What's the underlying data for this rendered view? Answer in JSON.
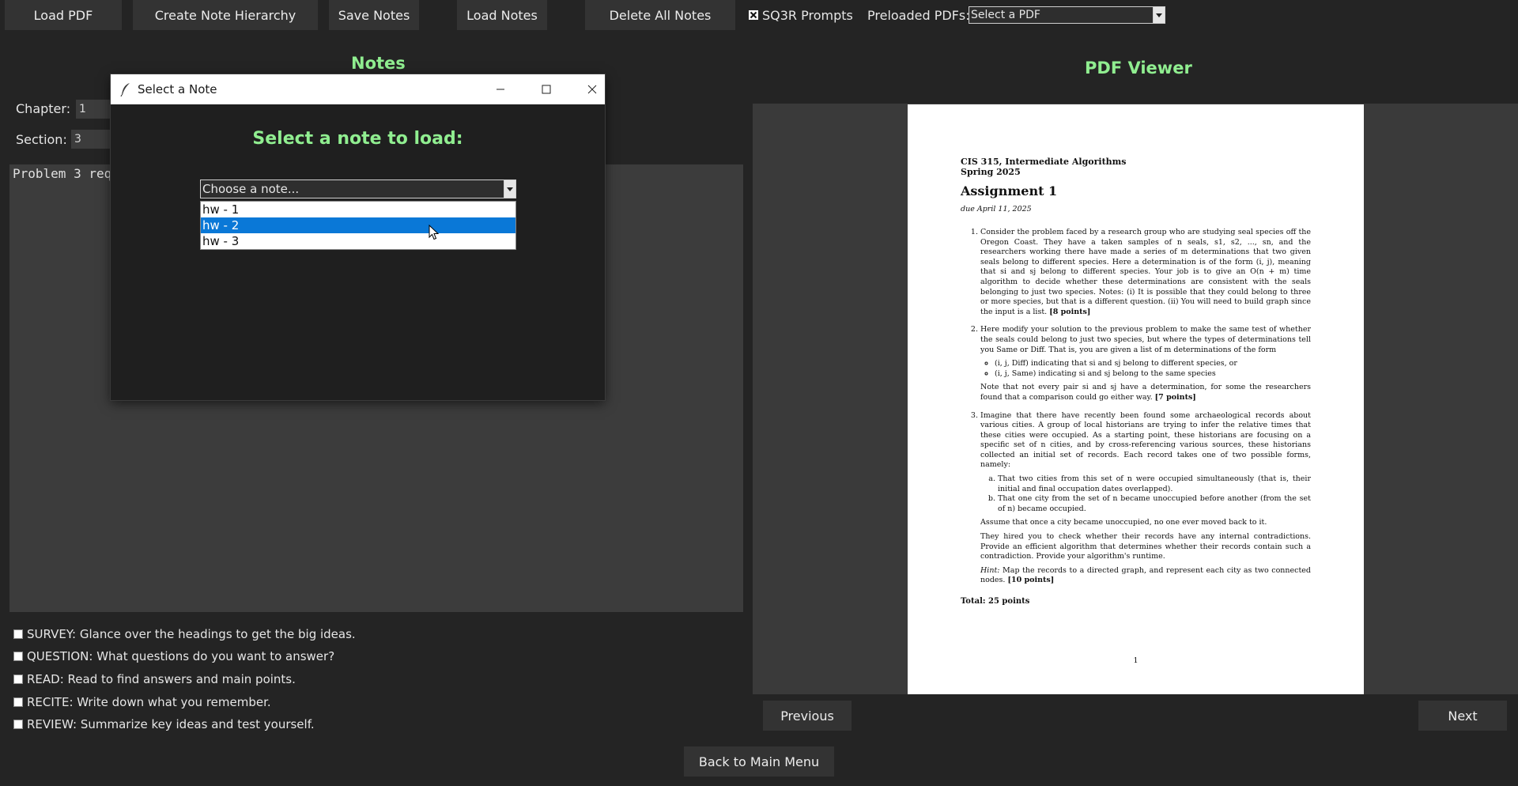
{
  "toolbar": {
    "load_pdf": "Load PDF",
    "create_note_hierarchy": "Create Note Hierarchy",
    "save_notes": "Save Notes",
    "load_notes": "Load Notes",
    "delete_all_notes": "Delete All Notes",
    "sq3r_label": "SQ3R Prompts",
    "sq3r_checked": true,
    "preloaded_label": "Preloaded PDFs:",
    "preloaded_value": "Select a PDF"
  },
  "notes": {
    "heading": "Notes",
    "chapter_label": "Chapter:",
    "chapter_value": "1",
    "section_label": "Section:",
    "section_value": "3",
    "text": "Problem 3 req"
  },
  "sq3r": [
    "SURVEY: Glance over the headings to get the big ideas.",
    "QUESTION: What questions do you want to answer?",
    "READ: Read to find answers and main points.",
    "RECITE: Write down what you remember.",
    "REVIEW: Summarize key ideas and test yourself."
  ],
  "pdf_viewer": {
    "heading": "PDF Viewer",
    "previous": "Previous",
    "next": "Next",
    "document": {
      "course": "CIS 315, Intermediate Algorithms",
      "term": "Spring 2025",
      "title": "Assignment 1",
      "due": "due April 11, 2025",
      "p1": "Consider the problem faced by a research group who are studying seal species off the Oregon Coast. They have a taken samples of n seals, s1, s2, ..., sn, and the researchers working there have made a series of m determinations that two given seals belong to different species. Here a determination is of the form (i, j), meaning that si and sj belong to different species. Your job is to give an O(n + m) time algorithm to decide whether these determinations are consistent with the seals belonging to just two species. Notes: (i) It is possible that they could belong to three or more species, but that is a different question. (ii) You will need to build graph since the input is a list.",
      "p1_points": "[8 points]",
      "p2": "Here modify your solution to the previous problem to make the same test of whether the seals could belong to just two species, but where the types of determinations tell you Same or Diff. That is, you are given a list of m determinations of the form",
      "p2_b1": "(i, j, Diff) indicating that si and sj belong to different species, or",
      "p2_b2": "(i, j, Same) indicating si and sj belong to the same species",
      "p2_note": "Note that not every pair si and sj have a determination, for some the researchers found that a comparison could go either way.",
      "p2_points": "[7 points]",
      "p3": "Imagine that there have recently been found some archaeological records about various cities. A group of local historians are trying to infer the relative times that these cities were occupied. As a starting point, these historians are focusing on a specific set of n cities, and by cross-referencing various sources, these historians collected an initial set of records. Each record takes one of two possible forms, namely:",
      "p3_a": "That two cities from this set of n were occupied simultaneously (that is, their initial and final occupation dates overlapped).",
      "p3_b": "That one city from the set of n became unoccupied before another (from the set of n) became occupied.",
      "p3_assume": "Assume that once a city became unoccupied, no one ever moved back to it.",
      "p3_hired": "They hired you to check whether their records have any internal contradictions. Provide an efficient algorithm that determines whether their records contain such a contradiction. Provide your algorithm's runtime.",
      "p3_hint_label": "Hint:",
      "p3_hint": "Map the records to a directed graph, and represent each city as two connected nodes.",
      "p3_points": "[10 points]",
      "total": "Total: 25 points",
      "page_number": "1"
    }
  },
  "back_button": "Back to Main Menu",
  "dialog": {
    "title": "Select a Note",
    "heading": "Select a note to load:",
    "combo_placeholder": "Choose a note...",
    "options": [
      "hw - 1",
      "hw - 2",
      "hw - 3"
    ],
    "highlighted_option": "hw - 2"
  },
  "colors": {
    "background": "#242424",
    "heading_green": "#90ee90",
    "selection_blue": "#0a78d7"
  }
}
